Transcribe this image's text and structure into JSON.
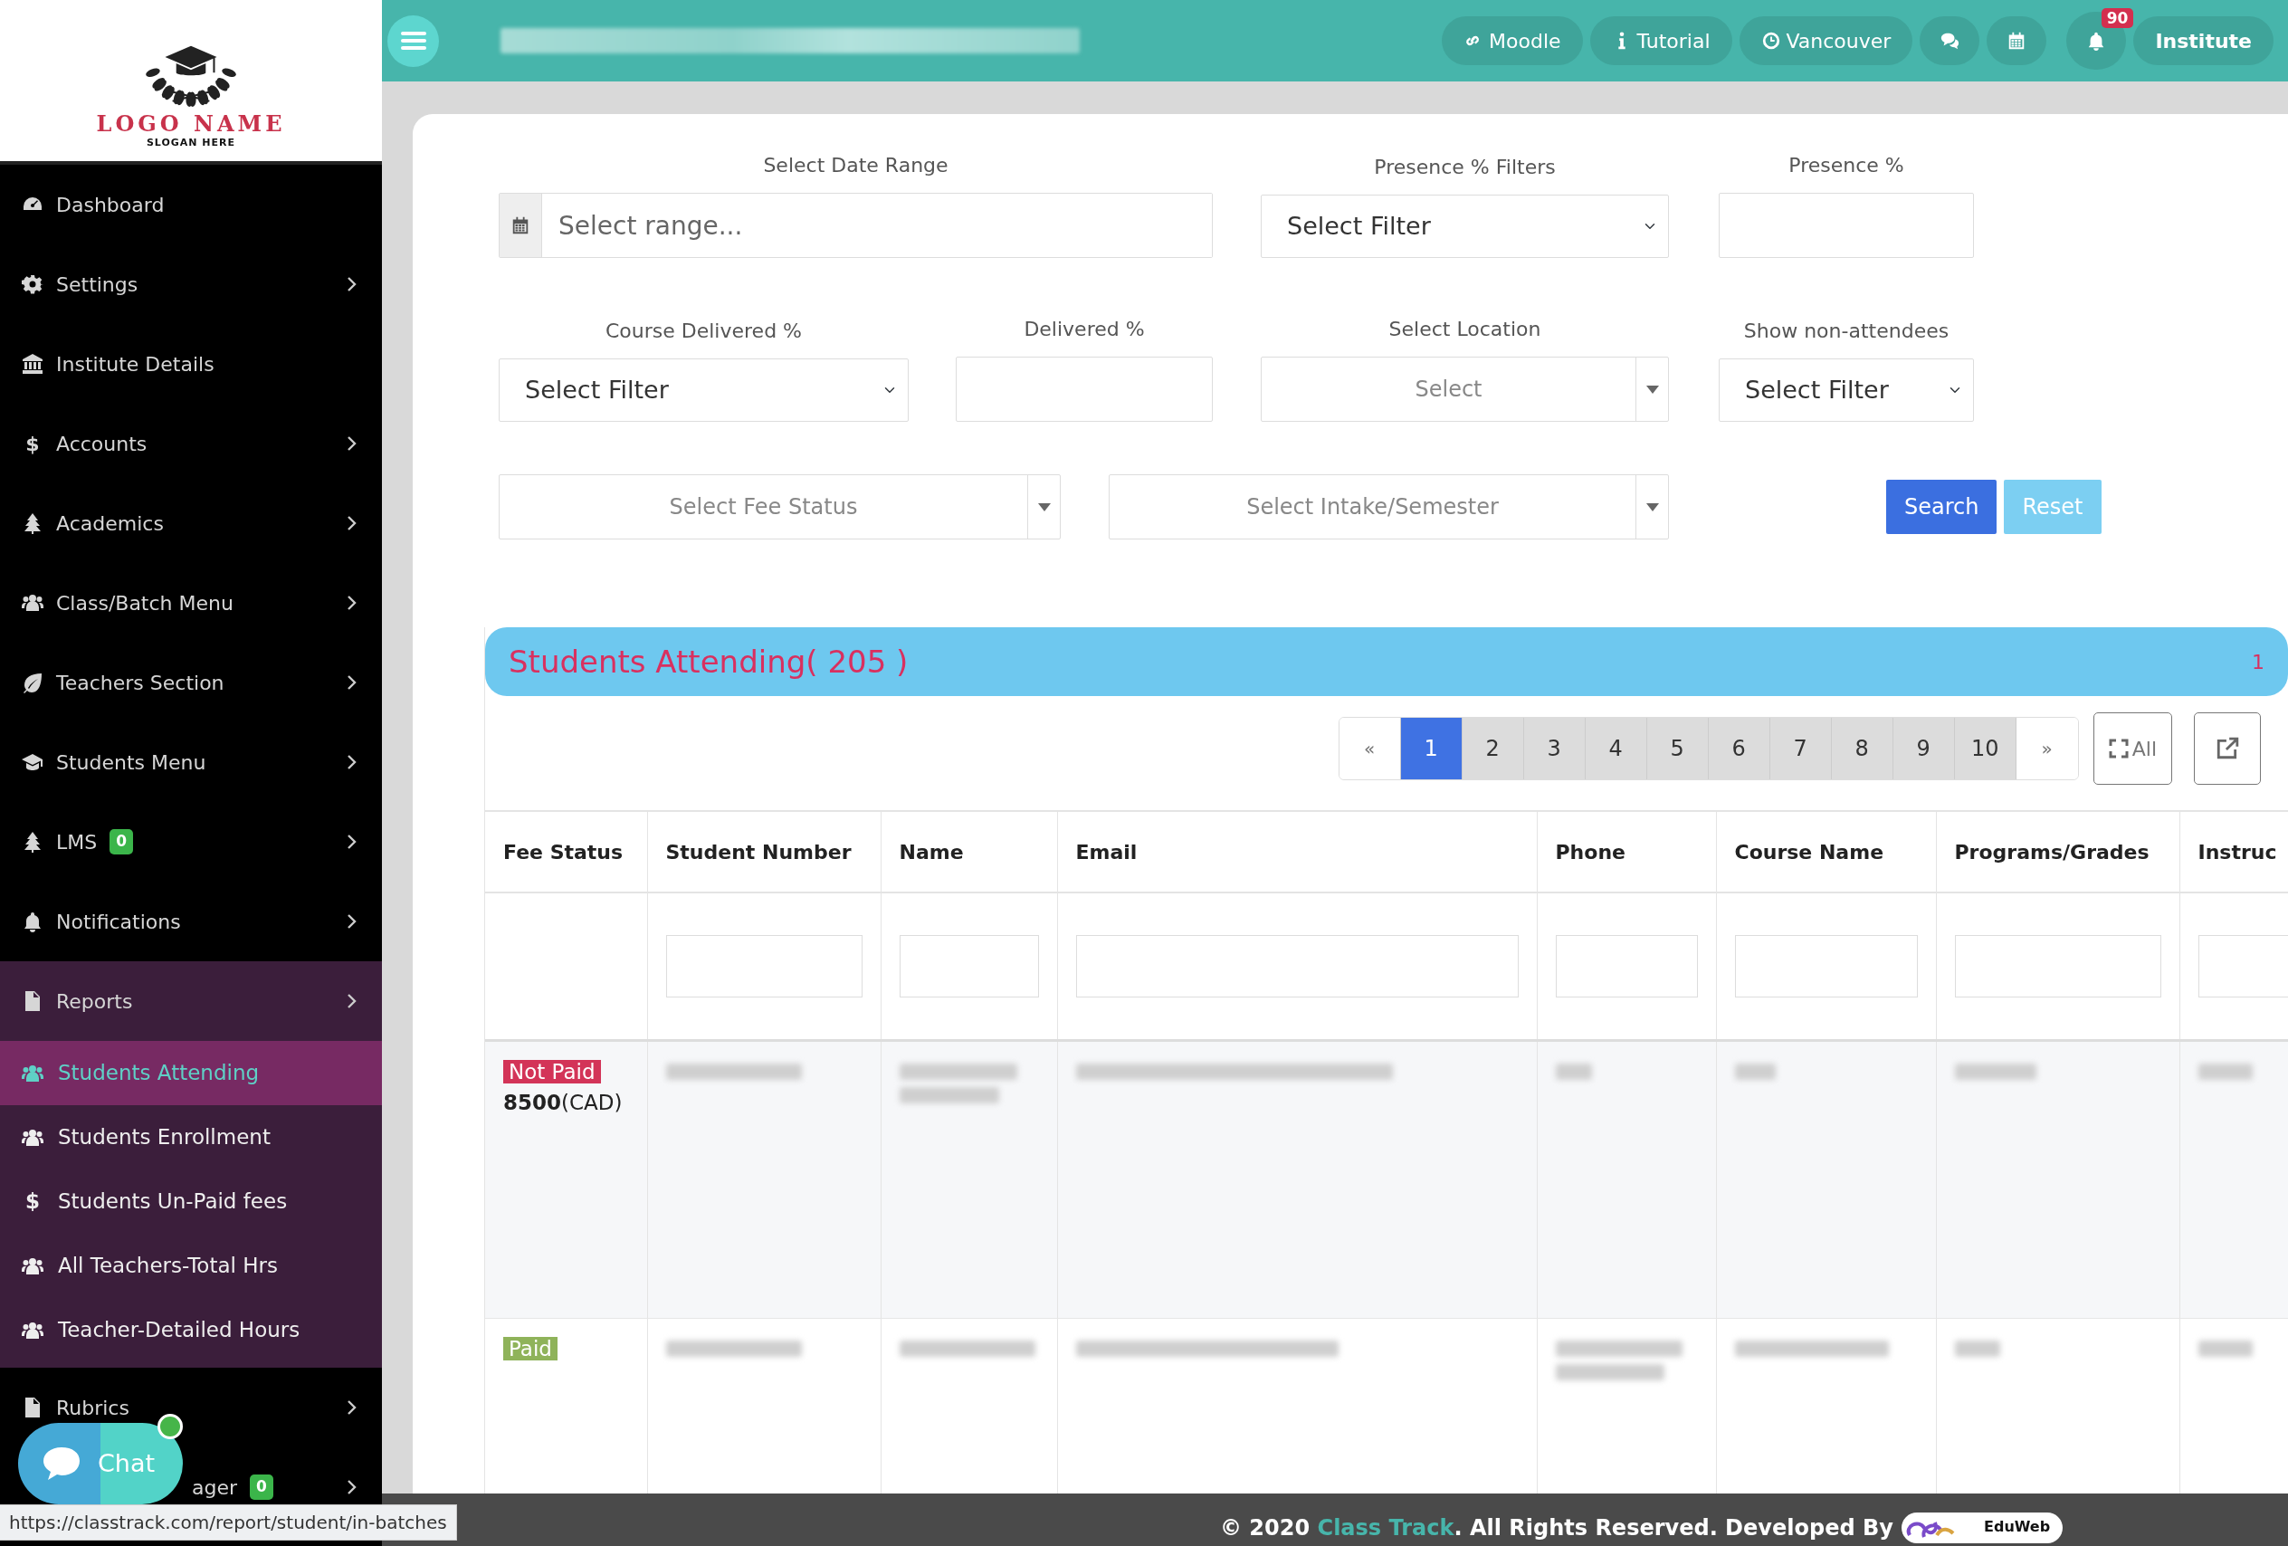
{
  "logo": {
    "name": "LOGO NAME",
    "slogan": "SLOGAN HERE"
  },
  "topbar": {
    "links": [
      {
        "label": "Moodle"
      },
      {
        "label": "Tutorial"
      },
      {
        "label": "Vancouver"
      }
    ],
    "notification_count": "90",
    "user": "Institute"
  },
  "sidebar": {
    "items": [
      {
        "label": "Dashboard",
        "expandable": false,
        "expanded": false
      },
      {
        "label": "Settings",
        "expandable": true,
        "expanded": false
      },
      {
        "label": "Institute Details",
        "expandable": false,
        "expanded": false
      },
      {
        "label": "Accounts",
        "icon_text": "$",
        "expandable": true,
        "expanded": false
      },
      {
        "label": "Academics",
        "expandable": true,
        "expanded": false
      },
      {
        "label": "Class/Batch Menu",
        "expandable": true,
        "expanded": false
      },
      {
        "label": "Teachers Section",
        "expandable": true,
        "expanded": false
      },
      {
        "label": "Students Menu",
        "expandable": true,
        "expanded": false
      },
      {
        "label": "LMS",
        "badge": "0",
        "expandable": true,
        "expanded": false
      },
      {
        "label": "Notifications",
        "expandable": true,
        "expanded": false
      },
      {
        "label": "Reports",
        "expandable": true,
        "expanded": true,
        "children": [
          {
            "label": "Students Attending",
            "selected": true
          },
          {
            "label": "Students Enrollment",
            "selected": false
          },
          {
            "label": "Students Un-Paid fees",
            "icon_text": "$",
            "selected": false
          },
          {
            "label": "All Teachers-Total Hrs",
            "selected": false
          },
          {
            "label": "Teacher-Detailed Hours",
            "selected": false
          }
        ]
      },
      {
        "label": "Rubrics",
        "expandable": true,
        "expanded": false
      },
      {
        "label": "ager",
        "badge": "0",
        "expandable": true,
        "expanded": false
      }
    ]
  },
  "filter_rows": [
    [
      {
        "label": "Select Date Range",
        "kind": "date",
        "placeholder": "Select range..."
      },
      {
        "label": "Presence % Filters",
        "kind": "select",
        "value": "Select Filter"
      },
      {
        "label": "Presence %",
        "kind": "input"
      }
    ],
    [
      {
        "label": "Course Delivered %",
        "kind": "select",
        "value": "Select Filter"
      },
      {
        "label": "Delivered %",
        "kind": "input"
      },
      {
        "label": "Select Location",
        "kind": "combo",
        "placeholder": "Select"
      },
      {
        "label": "Show non-attendees",
        "kind": "select",
        "value": "Select Filter"
      }
    ],
    [
      {
        "kind": "combo",
        "placeholder": "Select Fee Status"
      },
      {
        "kind": "combo",
        "placeholder": "Select Intake/Semester"
      }
    ]
  ],
  "actions": [
    {
      "label": "Search",
      "kind": "primary"
    },
    {
      "label": "Reset",
      "kind": "info"
    }
  ],
  "panel": {
    "title": "Students Attending( 205 )",
    "page_indicator": "1",
    "pagination": {
      "prev": "«",
      "pages": [
        {
          "label": "1",
          "selected": true
        },
        {
          "label": "2",
          "selected": false
        },
        {
          "label": "3",
          "selected": false
        },
        {
          "label": "4",
          "selected": false
        },
        {
          "label": "5",
          "selected": false
        },
        {
          "label": "6",
          "selected": false
        },
        {
          "label": "7",
          "selected": false
        },
        {
          "label": "8",
          "selected": false
        },
        {
          "label": "9",
          "selected": false
        },
        {
          "label": "10",
          "selected": false
        }
      ],
      "next": "»"
    },
    "all_button": "All"
  },
  "table": {
    "columns": [
      "Fee Status",
      "Student Number",
      "Name",
      "Email",
      "Phone",
      "Course Name",
      "Programs/Grades",
      "Instruc"
    ],
    "rows": [
      {
        "fee_status": "Not Paid",
        "paid": false,
        "amount": "**8500**(CAD)"
      },
      {
        "fee_status": "Paid",
        "paid": true
      }
    ]
  },
  "chat_widget": {
    "label": "Chat",
    "online": true
  },
  "status_url": "https://classtrack.com/report/student/in-batches",
  "footer": {
    "before": "© 2020 ",
    "brand": "Class Track",
    "after": ". All Rights Reserved. Developed By",
    "developer_logo": "EduWeb"
  }
}
